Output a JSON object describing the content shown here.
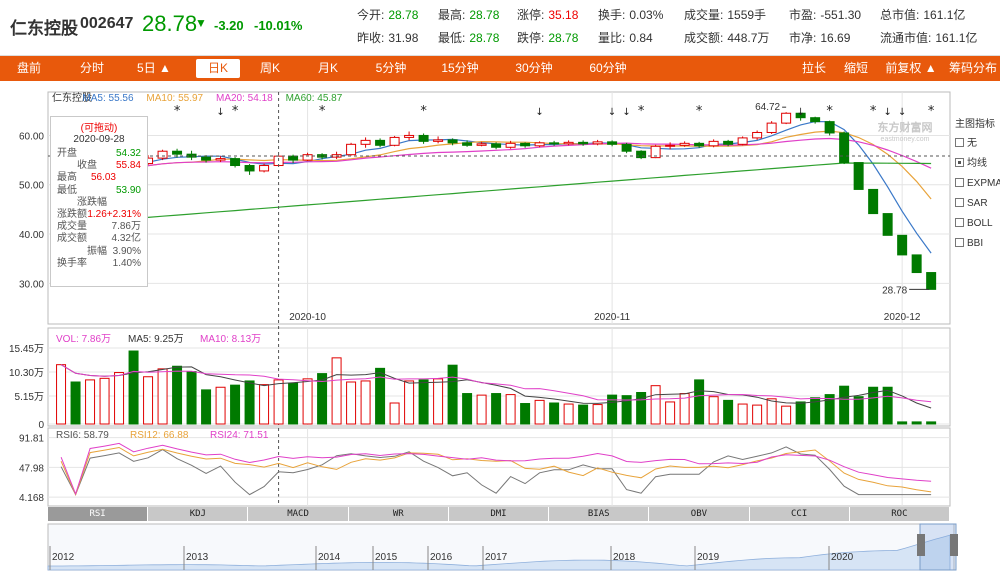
{
  "quote": {
    "name": "仁东控股",
    "code": "002647",
    "price": "28.78",
    "change": "-3.20",
    "change_pct": "-10.01%",
    "fields": [
      {
        "label": "今开:",
        "value": "28.78",
        "tone": "green"
      },
      {
        "label": "最高:",
        "value": "28.78",
        "tone": "green"
      },
      {
        "label": "涨停:",
        "value": "35.18",
        "tone": "red"
      },
      {
        "label": "换手:",
        "value": "0.03%",
        "tone": ""
      },
      {
        "label": "成交量:",
        "value": "1559手",
        "tone": ""
      },
      {
        "label": "市盈:",
        "value": "-551.30",
        "tone": ""
      },
      {
        "label": "总市值:",
        "value": "161.1亿",
        "tone": ""
      },
      {
        "label": "昨收:",
        "value": "31.98",
        "tone": ""
      },
      {
        "label": "最低:",
        "value": "28.78",
        "tone": "green"
      },
      {
        "label": "跌停:",
        "value": "28.78",
        "tone": "green"
      },
      {
        "label": "量比:",
        "value": "0.84",
        "tone": ""
      },
      {
        "label": "成交额:",
        "value": "448.7万",
        "tone": ""
      },
      {
        "label": "市净:",
        "value": "16.69",
        "tone": ""
      },
      {
        "label": "流通市值:",
        "value": "161.1亿",
        "tone": ""
      }
    ]
  },
  "toolbar": {
    "left": [
      "盘前",
      "分时",
      "5日 ▲",
      "日K",
      "周K",
      "月K",
      "5分钟",
      "15分钟",
      "30分钟",
      "60分钟"
    ],
    "right": [
      "拉长",
      "缩短",
      "前复权 ▲",
      "筹码分布"
    ],
    "active": "日K"
  },
  "kline_legend": [
    {
      "text": "仁东控股",
      "color": "#333333"
    },
    {
      "text": "MA5: 55.56",
      "color": "#3a78c8"
    },
    {
      "text": "MA10: 55.97",
      "color": "#e8a33a"
    },
    {
      "text": "MA20: 54.18",
      "color": "#e040c8"
    },
    {
      "text": "MA60: 45.87",
      "color": "#2ea02e"
    }
  ],
  "tooltip": {
    "title": "(可拖动)",
    "date": "2020-09-28",
    "rows": [
      {
        "label": "开盘",
        "value": "54.32",
        "tone": "green"
      },
      {
        "label": "收盘",
        "value": "55.84",
        "tone": "red"
      },
      {
        "label": "最高",
        "value": "56.03",
        "tone": "red"
      },
      {
        "label": "最低",
        "value": "53.90",
        "tone": "green"
      },
      {
        "label": "涨跌幅",
        "value": "+2.31%",
        "tone": "red"
      },
      {
        "label": "涨跌额",
        "value": "1.26",
        "tone": "red"
      },
      {
        "label": "成交量",
        "value": "7.86万",
        "tone": ""
      },
      {
        "label": "成交额",
        "value": "4.32亿",
        "tone": ""
      },
      {
        "label": "振幅",
        "value": "3.90%",
        "tone": ""
      },
      {
        "label": "换手率",
        "value": "1.40%",
        "tone": ""
      }
    ]
  },
  "right_panel": {
    "title": "主图指标",
    "options": [
      "无",
      "均线",
      "EXPMA",
      "SAR",
      "BOLL",
      "BBI"
    ],
    "selected": "均线"
  },
  "watermark": {
    "cn": "东方财富网",
    "en": "eastmoney.com"
  },
  "annotations": {
    "high": "64.72",
    "last": "28.78"
  },
  "price_axis": [
    "60.00",
    "50.00",
    "40.00",
    "30.00"
  ],
  "date_axis": [
    "2020-10",
    "2020-11",
    "2020-12"
  ],
  "volume_legend": [
    {
      "text": "VOL: 7.86万",
      "color": "#e040c8"
    },
    {
      "text": "MA5: 9.25万",
      "color": "#333333"
    },
    {
      "text": "MA10: 8.13万",
      "color": "#e040c8"
    }
  ],
  "volume_axis": [
    "15.45万",
    "10.30万",
    "5.15万",
    "0"
  ],
  "rsi_legend": [
    {
      "text": "RSI6: 58.79",
      "color": "#555555"
    },
    {
      "text": "RSI12: 66.88",
      "color": "#e8a33a"
    },
    {
      "text": "RSI24: 71.51",
      "color": "#e040c8"
    }
  ],
  "rsi_axis": [
    "91.81",
    "47.98",
    "4.168"
  ],
  "indicator_tabs": [
    "RSI",
    "KDJ",
    "MACD",
    "WR",
    "DMI",
    "BIAS",
    "OBV",
    "CCI",
    "ROC"
  ],
  "active_tab": "RSI",
  "timeline_years": [
    "2012",
    "2013",
    "2014",
    "2015",
    "2016",
    "2017",
    "2018",
    "2019",
    "2020"
  ],
  "colors": {
    "up": "#e00000",
    "down": "#007a00",
    "brand": "#e8590c"
  },
  "chart_data": {
    "type": "candlestick",
    "candles": [
      [
        50.3,
        52.5,
        50.0,
        53.0
      ],
      [
        52.5,
        51.8,
        51.3,
        53.2
      ],
      [
        51.8,
        53.8,
        51.5,
        54.0
      ],
      [
        53.8,
        54.3,
        53.0,
        55.0
      ],
      [
        54.3,
        55.1,
        53.8,
        55.5
      ],
      [
        55.1,
        54.3,
        53.7,
        55.8
      ],
      [
        54.3,
        55.4,
        54.0,
        56.0
      ],
      [
        55.4,
        56.8,
        55.0,
        57.1
      ],
      [
        56.8,
        56.2,
        55.5,
        57.3
      ],
      [
        56.2,
        55.6,
        55.0,
        56.9
      ],
      [
        55.6,
        55.0,
        54.5,
        56.0
      ],
      [
        55.0,
        55.3,
        54.6,
        55.8
      ],
      [
        55.3,
        53.9,
        53.5,
        55.6
      ],
      [
        53.9,
        52.8,
        52.0,
        54.2
      ],
      [
        52.8,
        53.9,
        52.5,
        54.3
      ],
      [
        53.9,
        55.8,
        53.9,
        56.0
      ],
      [
        55.8,
        55.0,
        54.4,
        56.1
      ],
      [
        55.0,
        56.1,
        54.8,
        56.5
      ],
      [
        56.1,
        55.6,
        55.1,
        56.4
      ],
      [
        55.6,
        56.1,
        55.2,
        56.7
      ],
      [
        56.1,
        58.2,
        55.9,
        58.5
      ],
      [
        58.2,
        59.0,
        57.5,
        59.6
      ],
      [
        59.0,
        58.0,
        57.6,
        59.4
      ],
      [
        58.0,
        59.6,
        57.8,
        59.9
      ],
      [
        59.6,
        60.0,
        59.0,
        60.8
      ],
      [
        60.0,
        58.8,
        58.3,
        60.4
      ],
      [
        58.8,
        59.1,
        58.4,
        59.8
      ],
      [
        59.1,
        58.5,
        58.0,
        59.4
      ],
      [
        58.5,
        58.0,
        57.7,
        59.0
      ],
      [
        58.0,
        58.3,
        57.8,
        58.7
      ],
      [
        58.3,
        57.6,
        57.2,
        58.6
      ],
      [
        57.6,
        58.4,
        57.3,
        58.9
      ],
      [
        58.4,
        57.9,
        57.5,
        58.6
      ],
      [
        57.9,
        58.5,
        57.6,
        58.8
      ],
      [
        58.5,
        58.3,
        57.9,
        58.9
      ],
      [
        58.3,
        58.6,
        58.0,
        59.0
      ],
      [
        58.6,
        58.3,
        57.9,
        59.0
      ],
      [
        58.3,
        58.7,
        58.0,
        59.1
      ],
      [
        58.7,
        58.2,
        57.8,
        59.0
      ],
      [
        58.2,
        56.8,
        56.4,
        58.5
      ],
      [
        56.8,
        55.5,
        55.2,
        57.0
      ],
      [
        55.5,
        57.8,
        55.4,
        58.1
      ],
      [
        57.8,
        58.0,
        57.2,
        58.6
      ],
      [
        58.0,
        58.4,
        57.7,
        58.8
      ],
      [
        58.4,
        57.9,
        57.5,
        58.7
      ],
      [
        57.9,
        58.8,
        57.6,
        59.2
      ],
      [
        58.8,
        58.2,
        57.8,
        59.1
      ],
      [
        58.2,
        59.5,
        58.0,
        59.8
      ],
      [
        59.5,
        60.6,
        59.1,
        61.0
      ],
      [
        60.6,
        62.5,
        60.3,
        62.9
      ],
      [
        62.5,
        64.5,
        62.3,
        64.72
      ],
      [
        64.5,
        63.6,
        63.0,
        64.7
      ],
      [
        63.6,
        62.8,
        62.4,
        63.8
      ],
      [
        62.8,
        60.5,
        60.0,
        63.0
      ],
      [
        60.5,
        54.5,
        54.2,
        60.8
      ],
      [
        54.5,
        49.05,
        49.05,
        54.5
      ],
      [
        49.05,
        44.15,
        44.15,
        44.15
      ],
      [
        44.15,
        39.74,
        39.74,
        39.74
      ],
      [
        39.74,
        35.77,
        35.77,
        35.77
      ],
      [
        35.77,
        32.19,
        32.19,
        32.19
      ],
      [
        32.19,
        28.78,
        28.78,
        28.78
      ]
    ],
    "volume": [
      11.3,
      8.0,
      8.4,
      8.7,
      9.8,
      13.9,
      9.0,
      10.5,
      11.0,
      10.0,
      6.5,
      7.0,
      7.4,
      8.2,
      7.5,
      8.4,
      7.8,
      8.6,
      9.6,
      12.6,
      8.0,
      8.2,
      10.6,
      4.0,
      8.2,
      8.4,
      8.6,
      11.2,
      5.8,
      5.5,
      5.8,
      5.6,
      3.9,
      4.5,
      4.0,
      3.8,
      3.6,
      3.7,
      5.5,
      5.4,
      6.0,
      7.3,
      4.2,
      5.8,
      8.4,
      5.2,
      4.5,
      3.8,
      3.6,
      4.8,
      3.4,
      4.2,
      5.0,
      5.6,
      7.2,
      5.2,
      7.0,
      7.0,
      0.4,
      0.4,
      0.4
    ],
    "price_range": [
      25,
      68
    ],
    "volume_range": [
      0,
      16
    ],
    "rsi_range": [
      0,
      100
    ]
  }
}
